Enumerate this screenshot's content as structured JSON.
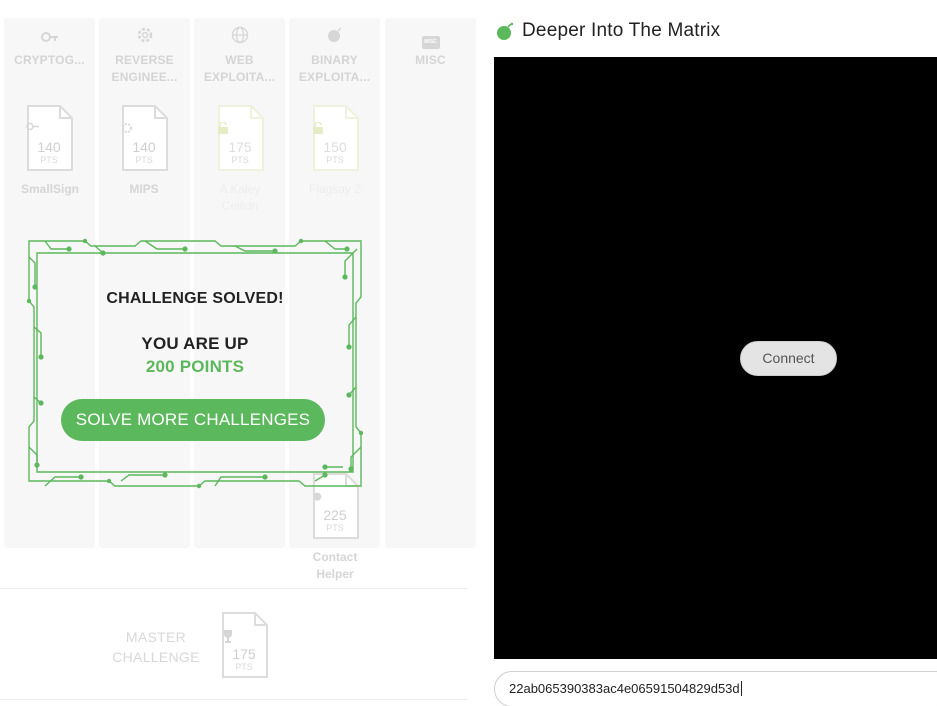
{
  "categories": [
    {
      "name": "CRYPTOG...",
      "icon": "key-icon"
    },
    {
      "name": "REVERSE ENGINEE...",
      "icon": "gear-icon"
    },
    {
      "name": "WEB EXPLOITA...",
      "icon": "globe-icon"
    },
    {
      "name": "BINARY EXPLOITA...",
      "icon": "bomb-icon"
    },
    {
      "name": "MISC",
      "icon": "misc-badge-icon",
      "badge": "MISC"
    }
  ],
  "challenges": [
    {
      "points": "140",
      "unit": "PTS",
      "label": "SmallSign",
      "state": "solved"
    },
    {
      "points": "140",
      "unit": "PTS",
      "label": "MIPS",
      "state": "solved"
    },
    {
      "points": "175",
      "unit": "PTS",
      "label": "A Kaley Ceilidh",
      "state": "locked"
    },
    {
      "points": "150",
      "unit": "PTS",
      "label": "Flagsay 2",
      "state": "locked"
    },
    {
      "points": "225",
      "unit": "PTS",
      "label": "Contact Helper",
      "state": "open"
    }
  ],
  "master": {
    "label": "MASTER CHALLENGE",
    "points": "175",
    "unit": "PTS"
  },
  "modal": {
    "title": "CHALLENGE SOLVED!",
    "subtitle": "YOU ARE UP",
    "points_text": "200 POINTS",
    "button": "SOLVE MORE CHALLENGES"
  },
  "panel": {
    "title": "Deeper Into The Matrix",
    "connect": "Connect",
    "flag_value": "22ab065390383ac4e06591504829d53d"
  },
  "colors": {
    "accent": "#5cb85c",
    "terminal": "#000000"
  }
}
